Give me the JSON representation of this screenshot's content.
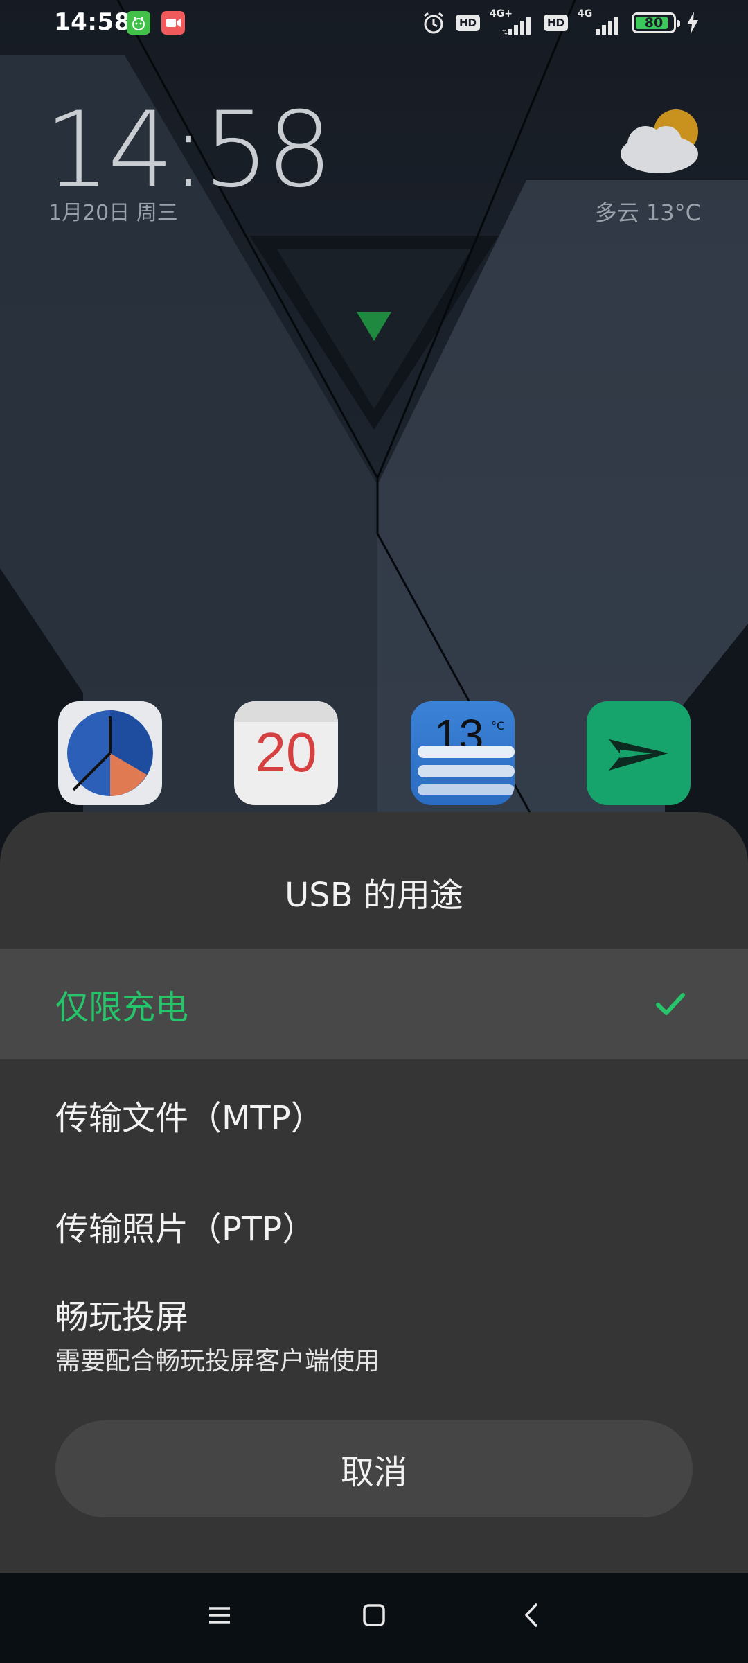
{
  "status_bar": {
    "time": "14:58",
    "hd1": "HD",
    "net1": "4G+",
    "hd2": "HD",
    "net2": "4G",
    "battery": "80"
  },
  "lockscreen": {
    "time": "14:58",
    "date": "1月20日 周三",
    "weather": "多云  13°C"
  },
  "apps": {
    "calendar_day": "20",
    "weather_temp": "13",
    "weather_unit": "°C"
  },
  "usb_sheet": {
    "title": "USB 的用途",
    "options": [
      {
        "label": "仅限充电",
        "selected": true
      },
      {
        "label": "传输文件（MTP）",
        "selected": false
      },
      {
        "label": "传输照片（PTP）",
        "selected": false
      },
      {
        "label": "畅玩投屏",
        "sublabel": "需要配合畅玩投屏客户端使用",
        "selected": false
      }
    ],
    "cancel": "取消"
  },
  "colors": {
    "accent": "#27c56b",
    "sheet_bg": "#353535",
    "selected_bg": "#484848"
  }
}
